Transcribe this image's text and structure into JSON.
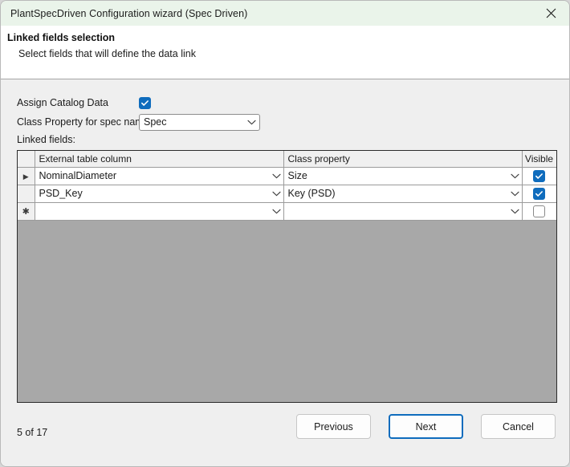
{
  "window": {
    "title": "PlantSpecDriven Configuration wizard (Spec Driven)",
    "close_icon": "close-icon",
    "titlebar_color": "#EAF4EA"
  },
  "header": {
    "title": "Linked fields selection",
    "subtitle": "Select fields that will define the data link"
  },
  "form": {
    "assign_catalog_data": {
      "label": "Assign Catalog Data",
      "checked": true
    },
    "class_property_for_spec_name": {
      "label": "Class Property for spec name",
      "value": "Spec",
      "options": [
        "Spec"
      ]
    },
    "linked_fields_label": "Linked fields:"
  },
  "grid": {
    "columns": [
      "External table column",
      "Class property",
      "Visible"
    ],
    "rows": [
      {
        "marker": "current-row-arrow",
        "external_table_column": "NominalDiameter",
        "class_property": "Size",
        "visible": true
      },
      {
        "marker": "",
        "external_table_column": "PSD_Key",
        "class_property": "Key (PSD)",
        "visible": true
      },
      {
        "marker": "new-row-asterisk",
        "external_table_column": "",
        "class_property": "",
        "visible": false
      }
    ]
  },
  "footer": {
    "page_indicator": "5 of 17",
    "buttons": [
      {
        "label": "Previous",
        "focused": false
      },
      {
        "label": "Next",
        "focused": true
      },
      {
        "label": "Cancel",
        "focused": false
      }
    ]
  },
  "colors": {
    "accent": "#0F6CBD",
    "titlebar": "#EAF4EA",
    "dialog_bg": "#EFEFEF",
    "grid_empty": "#A8A8A8"
  }
}
